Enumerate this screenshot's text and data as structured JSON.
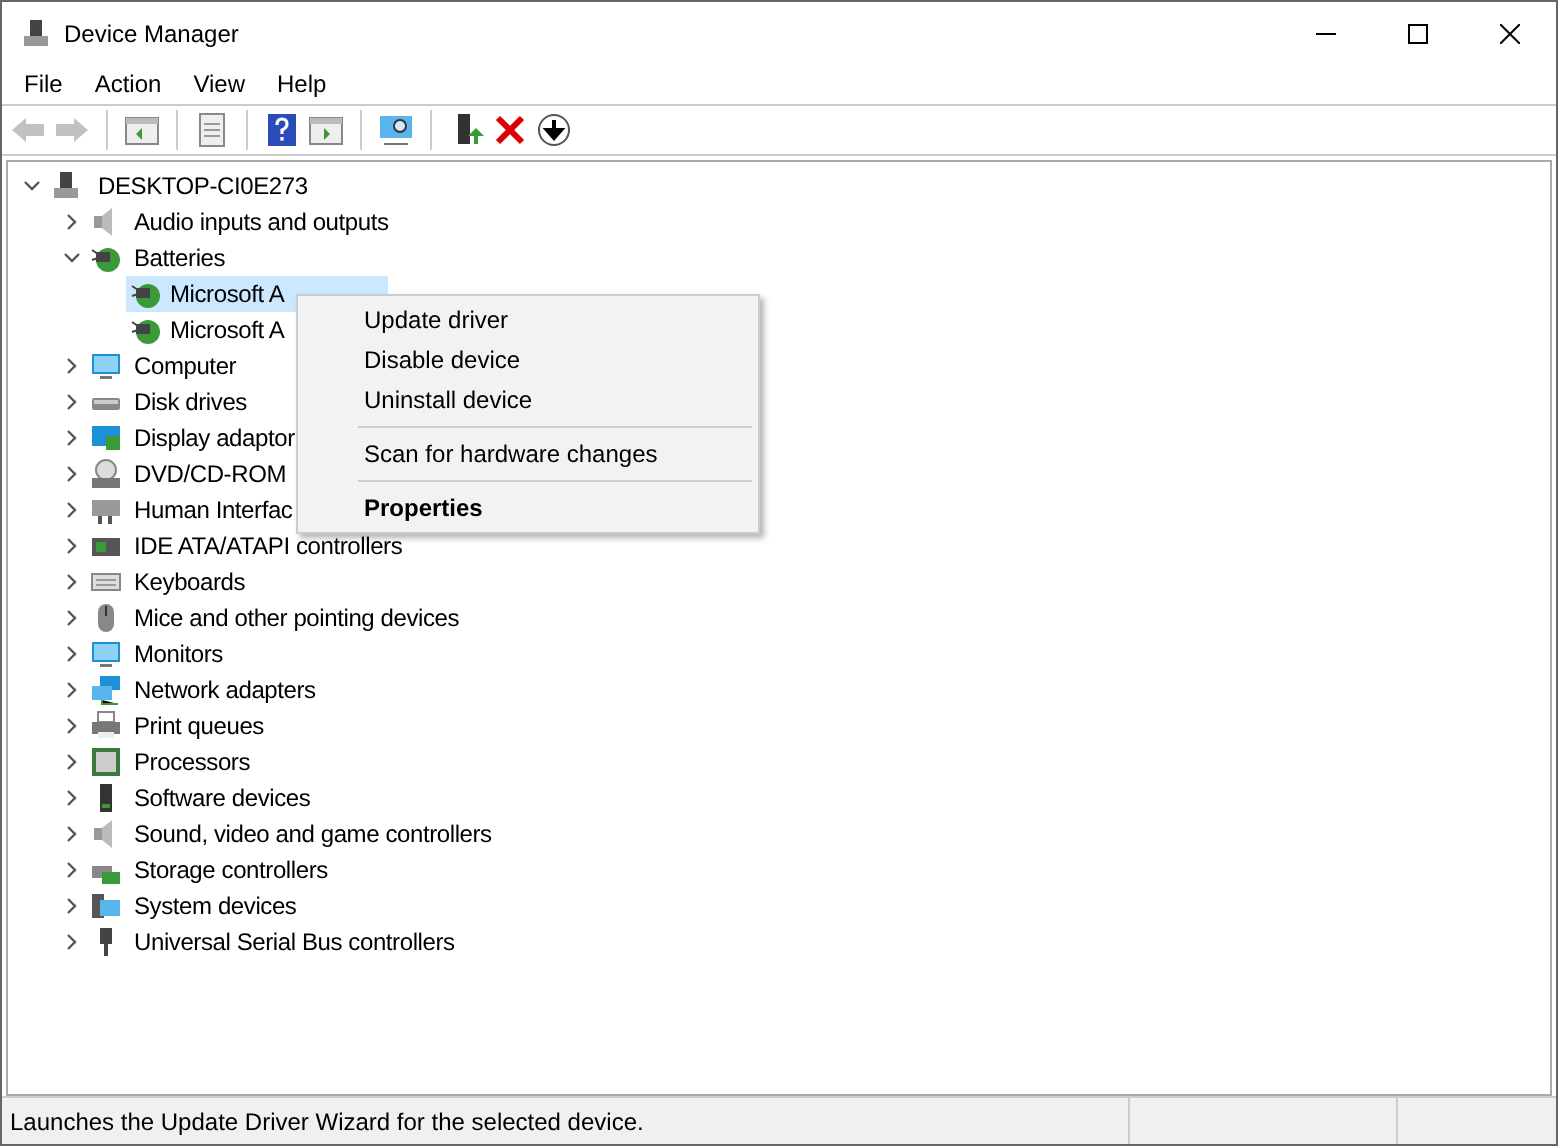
{
  "window": {
    "title": "Device Manager"
  },
  "menu_bar": [
    "File",
    "Action",
    "View",
    "Help"
  ],
  "tree": {
    "label": "DESKTOP-CI0E273",
    "expanded": true,
    "children": [
      {
        "label": "Audio inputs and outputs",
        "expanded": false
      },
      {
        "label": "Batteries",
        "expanded": true,
        "children": [
          {
            "label": "Microsoft A",
            "selected": true
          },
          {
            "label": "Microsoft A",
            "selected": false
          }
        ]
      },
      {
        "label": "Computer",
        "expanded": false
      },
      {
        "label": "Disk drives",
        "expanded": false
      },
      {
        "label": "Display adaptor",
        "expanded": false
      },
      {
        "label": "DVD/CD-ROM",
        "expanded": false
      },
      {
        "label": "Human Interfac",
        "expanded": false
      },
      {
        "label": "IDE ATA/ATAPI controllers",
        "expanded": false
      },
      {
        "label": "Keyboards",
        "expanded": false
      },
      {
        "label": "Mice and other pointing devices",
        "expanded": false
      },
      {
        "label": "Monitors",
        "expanded": false
      },
      {
        "label": "Network adapters",
        "expanded": false
      },
      {
        "label": "Print queues",
        "expanded": false
      },
      {
        "label": "Processors",
        "expanded": false
      },
      {
        "label": "Software devices",
        "expanded": false
      },
      {
        "label": "Sound, video and game controllers",
        "expanded": false
      },
      {
        "label": "Storage controllers",
        "expanded": false
      },
      {
        "label": "System devices",
        "expanded": false
      },
      {
        "label": "Universal Serial Bus controllers",
        "expanded": false
      }
    ]
  },
  "context_menu": [
    {
      "kind": "item",
      "label": "Update driver"
    },
    {
      "kind": "item",
      "label": "Disable device"
    },
    {
      "kind": "item",
      "label": "Uninstall device"
    },
    {
      "kind": "separator"
    },
    {
      "kind": "item",
      "label": "Scan for hardware changes"
    },
    {
      "kind": "separator"
    },
    {
      "kind": "default",
      "label": "Properties"
    }
  ],
  "status_bar": {
    "text": "Launches the Update Driver Wizard for the selected device."
  }
}
